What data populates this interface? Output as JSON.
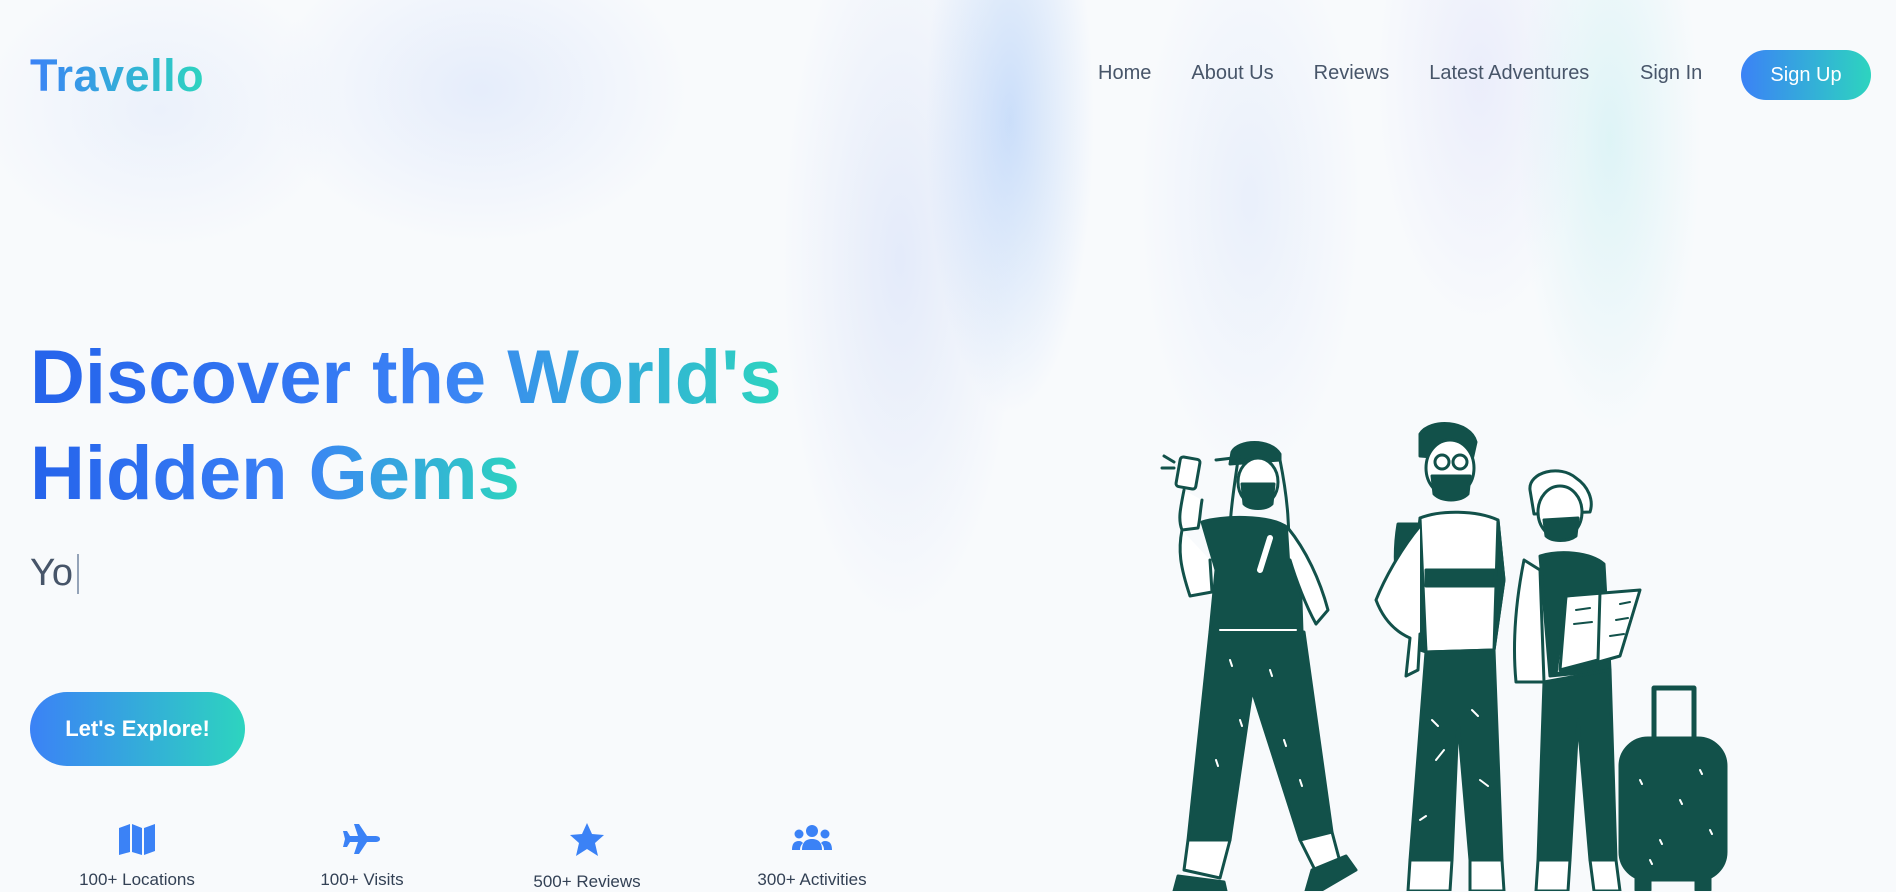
{
  "brand": {
    "name": "Travello",
    "colors": {
      "primary": "#3b82f6",
      "accent": "#2dd4bf",
      "illustration": "#12514a"
    }
  },
  "nav": {
    "links": [
      "Home",
      "About Us",
      "Reviews",
      "Latest Adventures"
    ],
    "sign_in": "Sign In",
    "sign_up": "Sign Up"
  },
  "hero": {
    "title_line1": "Discover the World's",
    "title_line2": "Hidden Gems",
    "typed_text": "Yo",
    "cta": "Let's Explore!"
  },
  "stats": [
    {
      "icon": "map-icon",
      "label": "100+ Locations"
    },
    {
      "icon": "plane-icon",
      "label": "100+ Visits"
    },
    {
      "icon": "star-icon",
      "label": "500+ Reviews"
    },
    {
      "icon": "users-icon",
      "label": "300+ Activities"
    }
  ],
  "illustration": {
    "icon": "travelers-illustration"
  }
}
